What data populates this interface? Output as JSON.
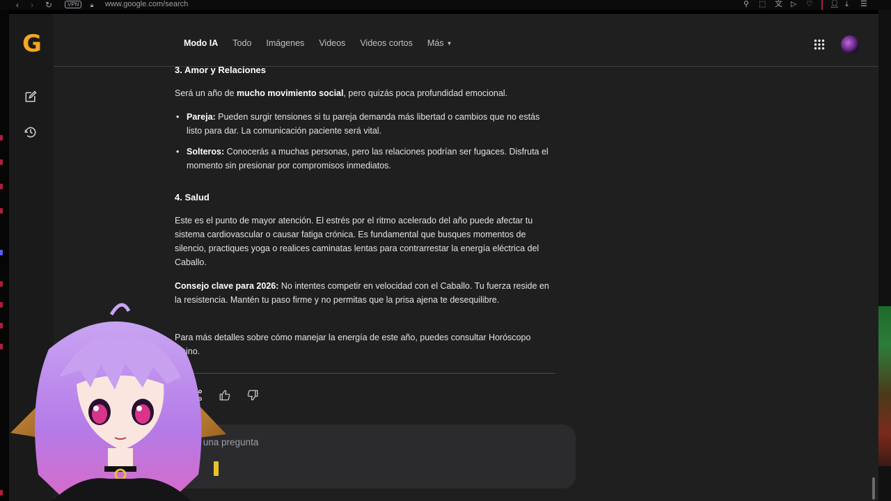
{
  "browser": {
    "url": "www.google.com/search",
    "vpn_label": "VPN"
  },
  "logo_letter": "G",
  "tabs": [
    {
      "label": "Modo IA",
      "active": true
    },
    {
      "label": "Todo"
    },
    {
      "label": "Imágenes"
    },
    {
      "label": "Videos"
    },
    {
      "label": "Videos cortos"
    },
    {
      "label": "Más"
    }
  ],
  "article": {
    "sec3_title": "3. Amor y Relaciones",
    "sec3_intro_pre": "Será un año de ",
    "sec3_intro_bold": "mucho movimiento social",
    "sec3_intro_post": ", pero quizás poca profundidad emocional.",
    "sec3_items": [
      {
        "label": "Pareja:",
        "text": " Pueden surgir tensiones si tu pareja demanda más libertad o cambios que no estás listo para dar. La comunicación paciente será vital."
      },
      {
        "label": "Solteros:",
        "text": " Conocerás a muchas personas, pero las relaciones podrían ser fugaces. Disfruta el momento sin presionar por compromisos inmediatos."
      }
    ],
    "sec4_title": "4. Salud",
    "sec4_text": "Este es el punto de mayor atención. El estrés por el ritmo acelerado del año puede afectar tu sistema cardiovascular o causar fatiga crónica. Es fundamental que busques momentos de silencio, practiques yoga o realices caminatas lentas para contrarrestar la energía eléctrica del Caballo.",
    "tip_label": "Consejo clave para 2026:",
    "tip_text": " No intentes competir en velocidad con el Caballo. Tu fuerza reside en la resistencia. Mantén tu paso firme y no permitas que la prisa ajena te desequilibre.",
    "more_text": "Para más detalles sobre cómo manejar la energía de este año, puedes consultar Horóscopo Chino."
  },
  "ask": {
    "placeholder": "Haz una pregunta"
  },
  "icons": {
    "rail": [
      "new-chat-icon",
      "history-icon"
    ],
    "feedback": [
      "share-icon",
      "thumbs-up-icon",
      "thumbs-down-icon"
    ],
    "header": [
      "apps-grid-icon",
      "profile-avatar"
    ]
  },
  "colors": {
    "background": "#1f1f1f",
    "logo": "#f5a623",
    "cursor": "#e8c22a"
  }
}
